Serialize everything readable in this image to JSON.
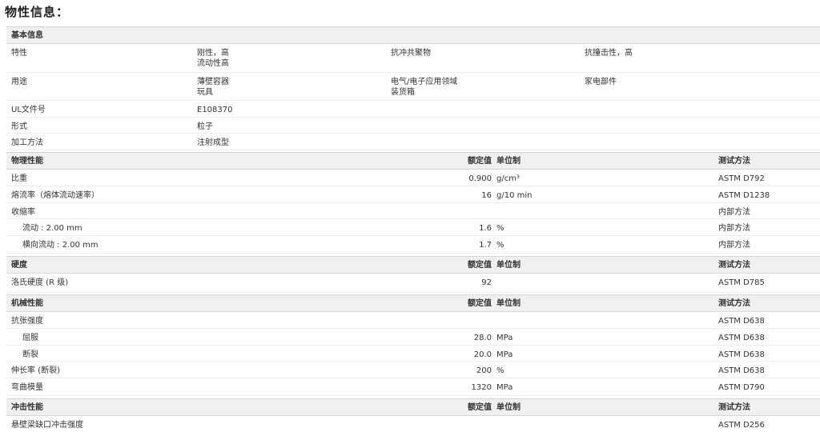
{
  "page_title": "物性信息：",
  "basic": {
    "header": "基本信息",
    "rows": [
      {
        "label": "特性",
        "col1": [
          "刚性，高",
          "流动性高"
        ],
        "col2": [
          "抗冲共聚物"
        ],
        "col3": [
          "抗撞击性，高"
        ]
      },
      {
        "label": "用途",
        "col1": [
          "薄壁容器",
          "玩具"
        ],
        "col2": [
          "电气/电子应用领域",
          "装货箱"
        ],
        "col3": [
          "家电部件"
        ]
      },
      {
        "label": "UL文件号",
        "col1": [
          "E108370"
        ],
        "col2": [],
        "col3": []
      },
      {
        "label": "形式",
        "col1": [
          "粒子"
        ],
        "col2": [],
        "col3": []
      },
      {
        "label": "加工方法",
        "col1": [
          "注射成型"
        ],
        "col2": [],
        "col3": []
      }
    ]
  },
  "sections": [
    {
      "title": "物理性能",
      "value_hdr": "额定值",
      "unit_hdr": "单位制",
      "method_hdr": "测试方法",
      "rows": [
        {
          "label": "比重",
          "value": "0.900",
          "unit": "g/cm³",
          "method": "ASTM D792"
        },
        {
          "label": "熔流率（熔体流动速率）",
          "value": "16",
          "unit": "g/10 min",
          "method": "ASTM D1238"
        },
        {
          "label": "收缩率",
          "value": "",
          "unit": "",
          "method": "内部方法"
        },
        {
          "label": "流动 : 2.00 mm",
          "value": "1.6",
          "unit": "%",
          "method": "内部方法"
        },
        {
          "label": "横向流动 : 2.00 mm",
          "value": "1.7",
          "unit": "%",
          "method": "内部方法"
        }
      ]
    },
    {
      "title": "硬度",
      "value_hdr": "额定值",
      "unit_hdr": "单位制",
      "method_hdr": "测试方法",
      "rows": [
        {
          "label": "洛氏硬度 (R 级)",
          "value": "92",
          "unit": "",
          "method": "ASTM D785"
        }
      ]
    },
    {
      "title": "机械性能",
      "value_hdr": "额定值",
      "unit_hdr": "单位制",
      "method_hdr": "测试方法",
      "rows": [
        {
          "label": "抗张强度",
          "value": "",
          "unit": "",
          "method": "ASTM D638"
        },
        {
          "label": "屈服",
          "value": "28.0",
          "unit": "MPa",
          "method": "ASTM D638"
        },
        {
          "label": "断裂",
          "value": "20.0",
          "unit": "MPa",
          "method": "ASTM D638"
        },
        {
          "label": "伸长率 (断裂)",
          "value": "200",
          "unit": "%",
          "method": "ASTM D638"
        },
        {
          "label": "弯曲模量",
          "value": "1320",
          "unit": "MPa",
          "method": "ASTM D790"
        }
      ]
    },
    {
      "title": "冲击性能",
      "value_hdr": "额定值",
      "unit_hdr": "单位制",
      "method_hdr": "测试方法",
      "rows": [
        {
          "label": "悬壁梁缺口冲击强度",
          "value": "",
          "unit": "",
          "method": "ASTM D256"
        }
      ]
    }
  ]
}
